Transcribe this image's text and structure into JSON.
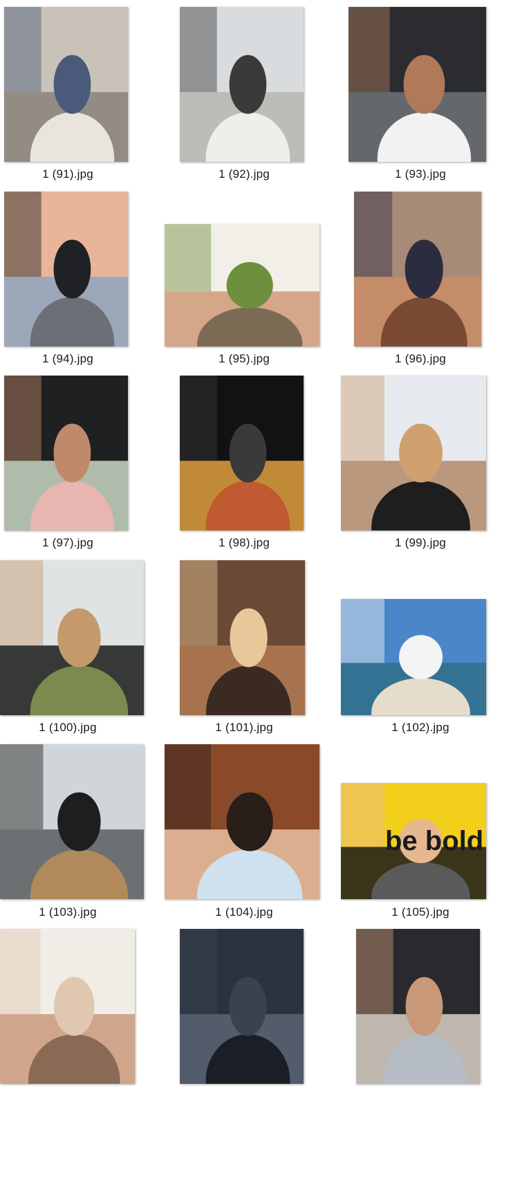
{
  "files": [
    {
      "name": "1 (91).jpg",
      "icon": "cathedral-selfie-photo",
      "colors": [
        "#c8c2b8",
        "#8a8378",
        "#e9e4dc",
        "#4a5a7a"
      ]
    },
    {
      "name": "1 (92).jpg",
      "icon": "office-selfie-photo",
      "colors": [
        "#d9dcde",
        "#b8b6b2",
        "#f0eeea",
        "#3a3a3a"
      ]
    },
    {
      "name": "1 (93).jpg",
      "icon": "car-selfie-photo",
      "colors": [
        "#2a2c30",
        "#6f7378",
        "#f2f2f2",
        "#b07a5a"
      ]
    },
    {
      "name": "1 (94).jpg",
      "icon": "city-view-photo",
      "colors": [
        "#e8b59a",
        "#8fa4c0",
        "#6c6f78",
        "#202124"
      ]
    },
    {
      "name": "1 (95).jpg",
      "icon": "lying-grass-photo",
      "colors": [
        "#f2efe8",
        "#d09a78",
        "#7d6a55",
        "#6e8f3e"
      ]
    },
    {
      "name": "1 (96).jpg",
      "icon": "shirtless-photo",
      "colors": [
        "#a88a78",
        "#c98c66",
        "#7a4a34",
        "#2c2c40"
      ]
    },
    {
      "name": "1 (97).jpg",
      "icon": "car-sunglasses-photo",
      "colors": [
        "#1f2022",
        "#c9d8c4",
        "#e8b5b0",
        "#c08a6a"
      ]
    },
    {
      "name": "1 (98).jpg",
      "icon": "night-reflection-photo",
      "colors": [
        "#121212",
        "#e0a040",
        "#c05a30",
        "#3a3a3a"
      ]
    },
    {
      "name": "1 (99).jpg",
      "icon": "couple-office-photo",
      "colors": [
        "#e6eaee",
        "#b08a6a",
        "#1e1e1e",
        "#d0a070"
      ]
    },
    {
      "name": "1 (100).jpg",
      "icon": "masked-couple-photo",
      "colors": [
        "#dfe3e4",
        "#1a1a1a",
        "#7b8b4e",
        "#c49a6c"
      ]
    },
    {
      "name": "1 (101).jpg",
      "icon": "gothic-facade-photo",
      "colors": [
        "#6a4a36",
        "#b07a52",
        "#3a2a22",
        "#e8c79a"
      ]
    },
    {
      "name": "1 (102).jpg",
      "icon": "lagoon-beach-photo",
      "colors": [
        "#4a86c8",
        "#2f6e8a",
        "#e6dccb",
        "#f4f4f4"
      ]
    },
    {
      "name": "1 (103).jpg",
      "icon": "gym-photo",
      "colors": [
        "#cfd5d8",
        "#5a5e62",
        "#b08a5a",
        "#1e1e1e"
      ]
    },
    {
      "name": "1 (104).jpg",
      "icon": "rose-couple-photo",
      "colors": [
        "#8a4a2a",
        "#e8c0a0",
        "#cfe0ee",
        "#2a1e1a"
      ]
    },
    {
      "name": "1 (105).jpg",
      "icon": "be-bold-wall-photo",
      "colors": [
        "#f2cf1a",
        "#1a1a1a",
        "#5a5a5a",
        "#e6b890"
      ]
    },
    {
      "name": "",
      "icon": "peace-sign-photo",
      "colors": [
        "#f0ece6",
        "#c99a7a",
        "#8a6a54",
        "#e0c8b0"
      ]
    },
    {
      "name": "",
      "icon": "sunset-silhouette-photo",
      "colors": [
        "#2a3240",
        "#5a6472",
        "#1a1e26",
        "#3a4250"
      ]
    },
    {
      "name": "",
      "icon": "car-blond-selfie-photo",
      "colors": [
        "#2a2a2e",
        "#d9d0c4",
        "#b5bcc4",
        "#c89878"
      ]
    }
  ],
  "overlay": {
    "be_bold_text": "be bold"
  }
}
